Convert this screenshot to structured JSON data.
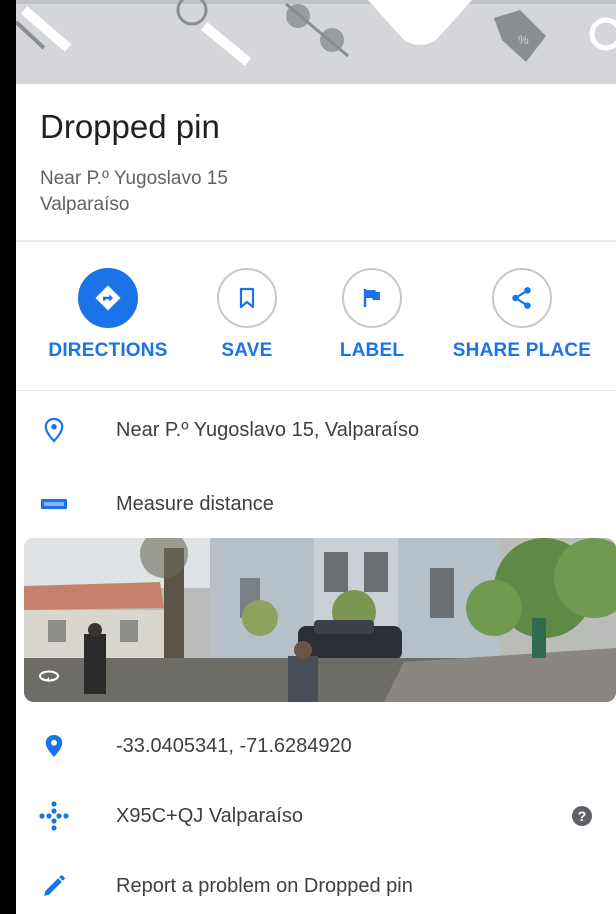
{
  "place": {
    "title": "Dropped pin",
    "address_line1": "Near P.º Yugoslavo 15",
    "address_line2": "Valparaíso"
  },
  "actions": [
    {
      "label": "DIRECTIONS",
      "icon": "directions-icon"
    },
    {
      "label": "SAVE",
      "icon": "bookmark-icon"
    },
    {
      "label": "LABEL",
      "icon": "flag-icon"
    },
    {
      "label": "SHARE PLACE",
      "icon": "share-icon"
    }
  ],
  "details": {
    "address": "Near P.º Yugoslavo 15, Valparaíso",
    "measure": "Measure distance",
    "coordinates": "-33.0405341, -71.6284920",
    "plus_code": "X95C+QJ Valparaíso",
    "report": "Report a problem on Dropped pin"
  },
  "colors": {
    "accent": "#1a73e8",
    "text_primary": "#202124",
    "text_secondary": "#5f6368"
  }
}
